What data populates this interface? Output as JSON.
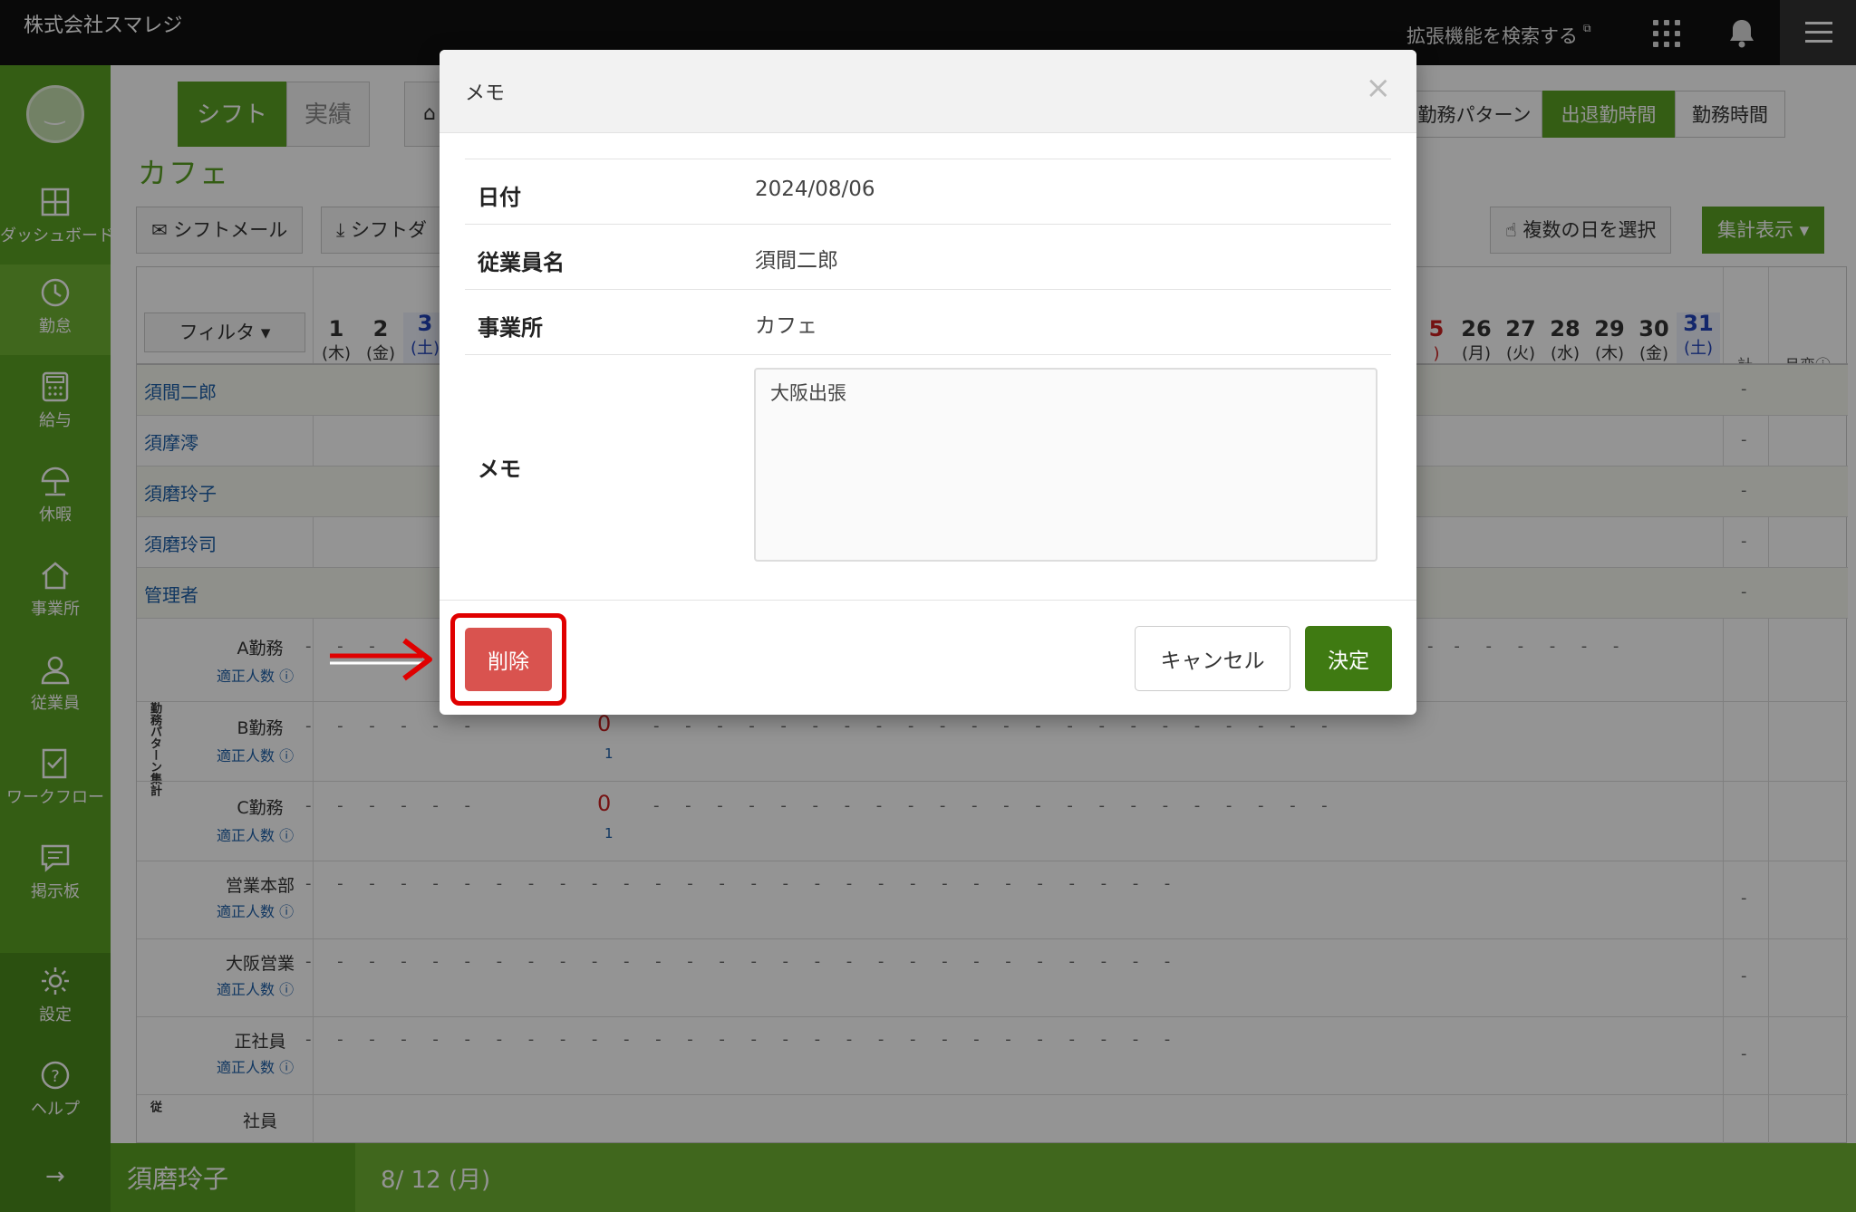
{
  "topbar": {
    "company": "株式会社スマレジ",
    "ext_search": "拡張機能を検索する",
    "ext_mark": "⧉"
  },
  "sidebar": {
    "items": [
      {
        "label": "ダッシュボード",
        "icon": "dashboard-icon"
      },
      {
        "label": "勤怠",
        "icon": "clock-icon"
      },
      {
        "label": "給与",
        "icon": "calculator-icon"
      },
      {
        "label": "休暇",
        "icon": "umbrella-icon"
      },
      {
        "label": "事業所",
        "icon": "home-icon"
      },
      {
        "label": "従業員",
        "icon": "person-icon"
      },
      {
        "label": "ワークフロー",
        "icon": "checklist-icon"
      },
      {
        "label": "掲示板",
        "icon": "chat-icon"
      },
      {
        "label": "設定",
        "icon": "gear-icon"
      },
      {
        "label": "ヘルプ",
        "icon": "help-icon"
      }
    ],
    "expand": "→"
  },
  "page": {
    "seg_shift": "シフト",
    "seg_actual": "実績",
    "views": [
      "勤務パターン",
      "出退勤時間",
      "勤務時間"
    ],
    "title": "カフェ",
    "btn_shift_mail": "シフトメール",
    "btn_shift_download": "シフトダ",
    "btn_multi_day": "複数の日を選択",
    "btn_summary": "集計表示 ▾",
    "filter": "フィルタ ▾",
    "days_left": [
      {
        "num": "1",
        "wd": "(木)",
        "type": "normal"
      },
      {
        "num": "2",
        "wd": "(金)",
        "type": "normal"
      },
      {
        "num": "3",
        "wd": "(土)",
        "type": "sat"
      }
    ],
    "days_right": [
      {
        "num": "5",
        "wd": ")",
        "type": "sun"
      },
      {
        "num": "26",
        "wd": "(月)",
        "type": "normal"
      },
      {
        "num": "27",
        "wd": "(火)",
        "type": "normal"
      },
      {
        "num": "28",
        "wd": "(水)",
        "type": "normal"
      },
      {
        "num": "29",
        "wd": "(木)",
        "type": "normal"
      },
      {
        "num": "30",
        "wd": "(金)",
        "type": "normal"
      },
      {
        "num": "31",
        "wd": "(土)",
        "type": "sat"
      }
    ],
    "total_label": "計",
    "month_change_label": "月変",
    "employees": [
      "須間二郎",
      "須摩澪",
      "須磨玲子",
      "須磨玲司",
      "管理者"
    ],
    "dash": "-",
    "pattern_group_label": "勤務パターン集計",
    "patterns": [
      {
        "name": "A勤務",
        "sub": "適正人数"
      },
      {
        "name": "B勤務",
        "sub": "適正人数"
      },
      {
        "name": "C勤務",
        "sub": "適正人数"
      }
    ],
    "departments": [
      {
        "name": "営業本部",
        "sub": "適正人数"
      },
      {
        "name": "大阪営業",
        "sub": "適正人数"
      },
      {
        "name": "正社員",
        "sub": "適正人数"
      }
    ],
    "cut_row": "社員",
    "cut_group": "従",
    "zero": "0",
    "one": "1"
  },
  "statusbar": {
    "name": "須磨玲子",
    "date": "8/ 12 (月)"
  },
  "modal": {
    "title": "メモ",
    "close": "×",
    "date_label": "日付",
    "date_value": "2024/08/06",
    "employee_label": "従業員名",
    "employee_value": "須間二郎",
    "office_label": "事業所",
    "office_value": "カフェ",
    "memo_label": "メモ",
    "memo_value": "大阪出張",
    "delete": "削除",
    "cancel": "キャンセル",
    "ok": "決定"
  },
  "colors": {
    "brand_green": "#5aa123",
    "ok_green": "#3f7a12",
    "delete_red": "#d9534f",
    "highlight_red": "#e00000"
  }
}
